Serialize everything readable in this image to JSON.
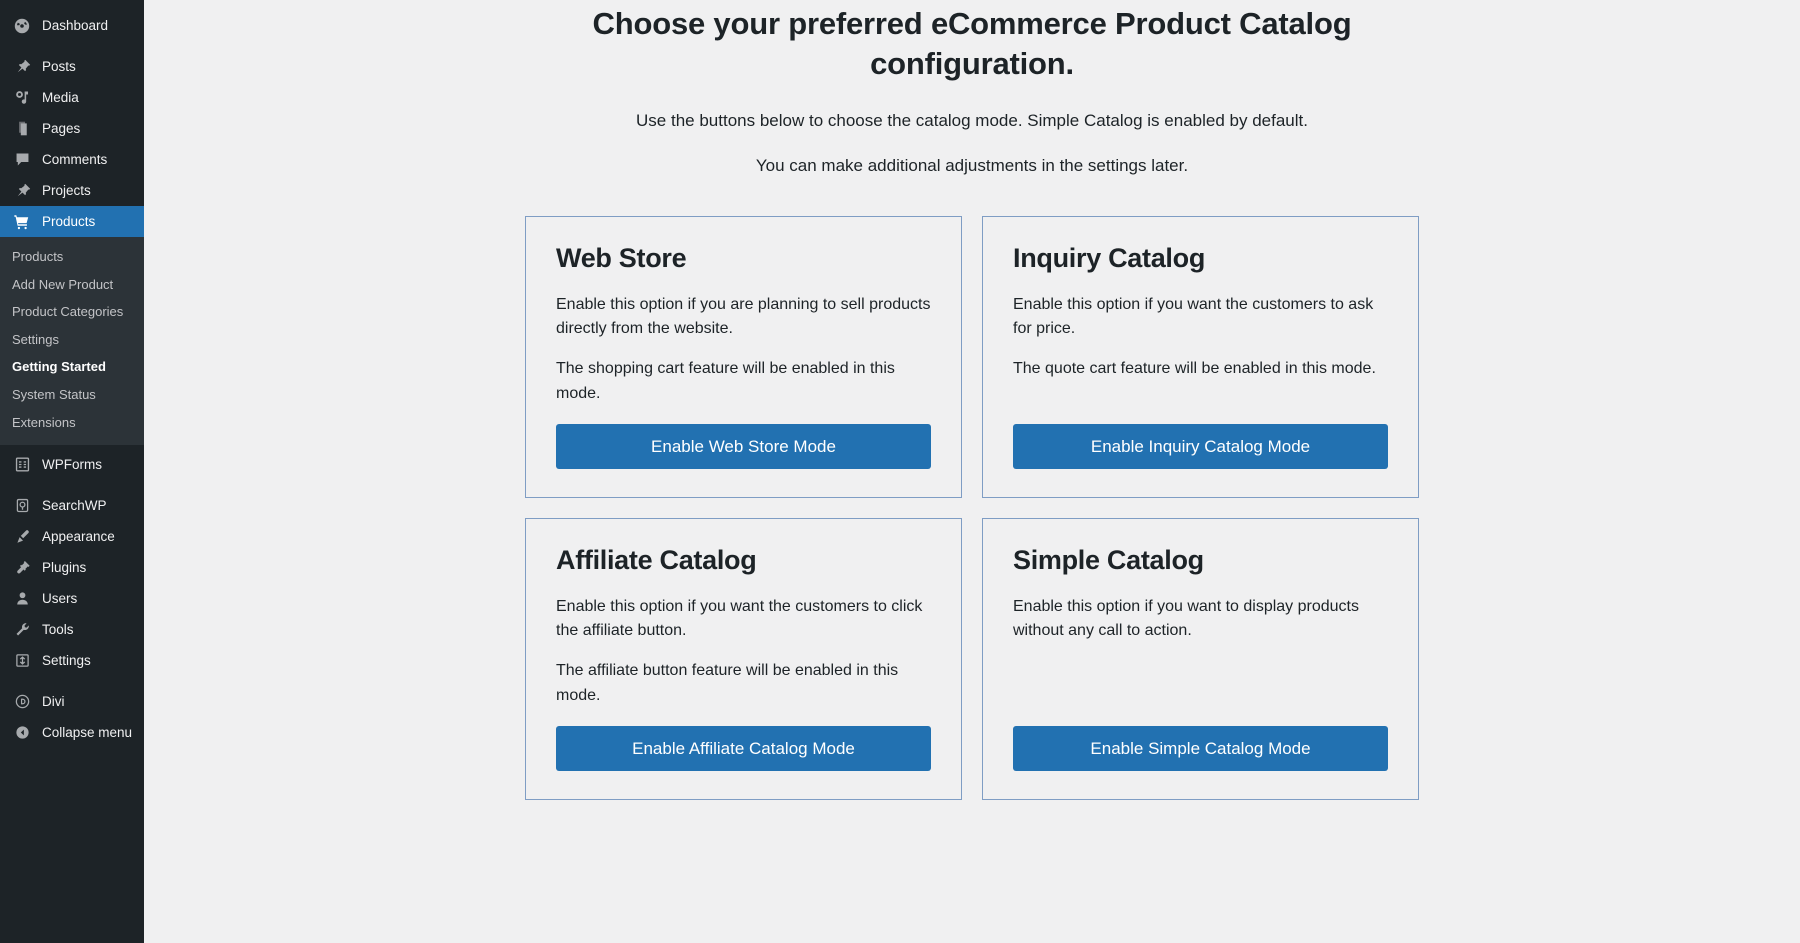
{
  "sidebar": {
    "items": [
      {
        "label": "Dashboard",
        "icon": "dashboard-icon",
        "current": false
      },
      {
        "label": "Posts",
        "icon": "pin-icon",
        "current": false
      },
      {
        "label": "Media",
        "icon": "media-icon",
        "current": false
      },
      {
        "label": "Pages",
        "icon": "pages-icon",
        "current": false
      },
      {
        "label": "Comments",
        "icon": "comments-icon",
        "current": false
      },
      {
        "label": "Projects",
        "icon": "pin-icon",
        "current": false
      },
      {
        "label": "Products",
        "icon": "cart-icon",
        "current": true
      }
    ],
    "submenu": [
      {
        "label": "Products",
        "current": false
      },
      {
        "label": "Add New Product",
        "current": false
      },
      {
        "label": "Product Categories",
        "current": false
      },
      {
        "label": "Settings",
        "current": false
      },
      {
        "label": "Getting Started",
        "current": true
      },
      {
        "label": "System Status",
        "current": false
      },
      {
        "label": "Extensions",
        "current": false
      }
    ],
    "items_after": [
      {
        "label": "WPForms",
        "icon": "wpforms-icon",
        "current": false
      },
      {
        "label": "SearchWP",
        "icon": "searchwp-icon",
        "current": false
      },
      {
        "label": "Appearance",
        "icon": "brush-icon",
        "current": false
      },
      {
        "label": "Plugins",
        "icon": "plugin-icon",
        "current": false
      },
      {
        "label": "Users",
        "icon": "user-icon",
        "current": false
      },
      {
        "label": "Tools",
        "icon": "wrench-icon",
        "current": false
      },
      {
        "label": "Settings",
        "icon": "settings-icon",
        "current": false
      }
    ],
    "items_bottom": [
      {
        "label": "Divi",
        "icon": "divi-icon",
        "current": false
      },
      {
        "label": "Collapse menu",
        "icon": "collapse-arrow-icon",
        "current": false
      }
    ],
    "colors": {
      "background": "#1d2327",
      "submenu_background": "#2c3338",
      "current_background": "#2271b1",
      "text": "#f0f0f1",
      "muted_text": "#c3c4c7"
    }
  },
  "page": {
    "title": "Choose your preferred eCommerce Product Catalog configuration.",
    "subtitle_1": "Use the buttons below to choose the catalog mode. Simple Catalog is enabled by default.",
    "subtitle_2": "You can make additional adjustments in the settings later.",
    "accent_color": "#2271b1",
    "card_border_color": "#7f9dc4",
    "background_color": "#f0f0f1"
  },
  "cards": [
    {
      "title": "Web Store",
      "desc_1": "Enable this option if you are planning to sell products directly from the website.",
      "desc_2": "The shopping cart feature will be enabled in this mode.",
      "button_label": "Enable Web Store Mode"
    },
    {
      "title": "Inquiry Catalog",
      "desc_1": "Enable this option if you want the customers to ask for price.",
      "desc_2": "The quote cart feature will be enabled in this mode.",
      "button_label": "Enable Inquiry Catalog Mode"
    },
    {
      "title": "Affiliate Catalog",
      "desc_1": "Enable this option if you want the customers to click the affiliate button.",
      "desc_2": "The affiliate button feature will be enabled in this mode.",
      "button_label": "Enable Affiliate Catalog Mode"
    },
    {
      "title": "Simple Catalog",
      "desc_1": "Enable this option if you want to display products without any call to action.",
      "desc_2": "",
      "button_label": "Enable Simple Catalog Mode"
    }
  ]
}
